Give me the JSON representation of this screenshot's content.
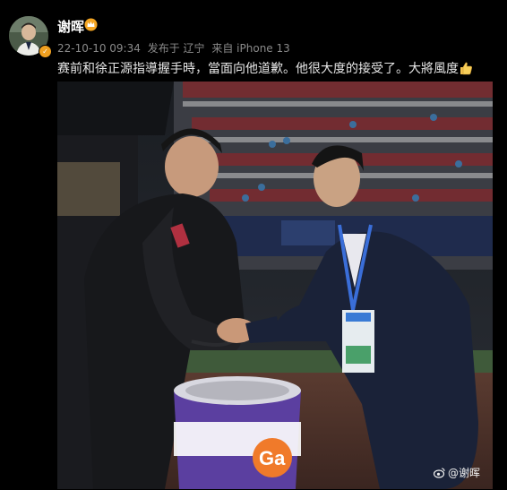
{
  "post": {
    "author": "谢晖",
    "timestamp": "22-10-10 09:34",
    "location": "发布于 辽宁",
    "device": "来自 iPhone 13",
    "text": "赛前和徐正源指導握手時，當面向他道歉。他很大度的接受了。大將風度",
    "emoji": "thumbs-up-emoji",
    "watermark": "@谢晖"
  },
  "icons": {
    "verified": "verified-badge-icon",
    "vip": "crown-vip-icon",
    "watermark": "weibo-logo-icon"
  },
  "colors": {
    "background": "#000000",
    "username": "#ffffff",
    "meta": "#8a8a8a",
    "text": "#e6e6e6",
    "verified": "#f0a020"
  }
}
